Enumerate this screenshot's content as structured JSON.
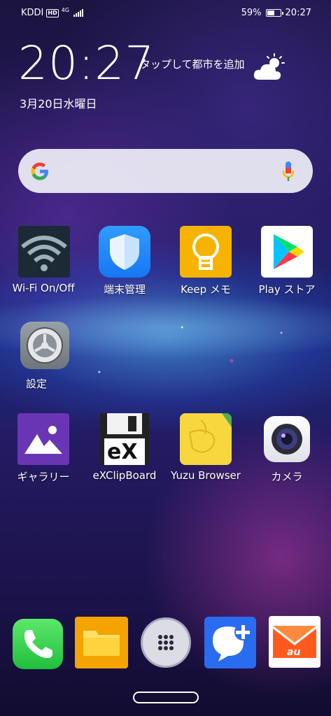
{
  "status_bar": {
    "carrier": "KDDI",
    "hd_badge": "HD",
    "network": "4G",
    "battery_percent": "59%",
    "battery_level": 0.59,
    "time": "20:27"
  },
  "clock_widget": {
    "time": "20:27",
    "city_prompt": "タップして都市を追加",
    "date": "3月20日水曜日",
    "weather_icon": "partly-cloudy-icon"
  },
  "search": {
    "left_icon": "google-g-icon",
    "right_icon": "microphone-icon"
  },
  "apps": [
    {
      "label": "Wi-Fi On/Off",
      "icon": "wifi-icon"
    },
    {
      "label": "端末管理",
      "icon": "shield-icon"
    },
    {
      "label": "Keep メモ",
      "icon": "keep-bulb-icon"
    },
    {
      "label": "Play ストア",
      "icon": "play-store-icon"
    },
    {
      "label": "設定",
      "icon": "settings-gear-icon"
    },
    {
      "label": "ギャラリー",
      "icon": "gallery-icon"
    },
    {
      "label": "eXClipBoard",
      "icon": "floppy-icon",
      "icon_text": "eX"
    },
    {
      "label": "Yuzu Browser",
      "icon": "yuzu-map-icon"
    },
    {
      "label": "カメラ",
      "icon": "camera-icon"
    }
  ],
  "dock": [
    {
      "icon": "phone-icon"
    },
    {
      "icon": "folder-icon"
    },
    {
      "icon": "app-drawer-icon"
    },
    {
      "icon": "messenger-plus-icon"
    },
    {
      "icon": "au-mail-icon",
      "icon_text": "au"
    }
  ]
}
